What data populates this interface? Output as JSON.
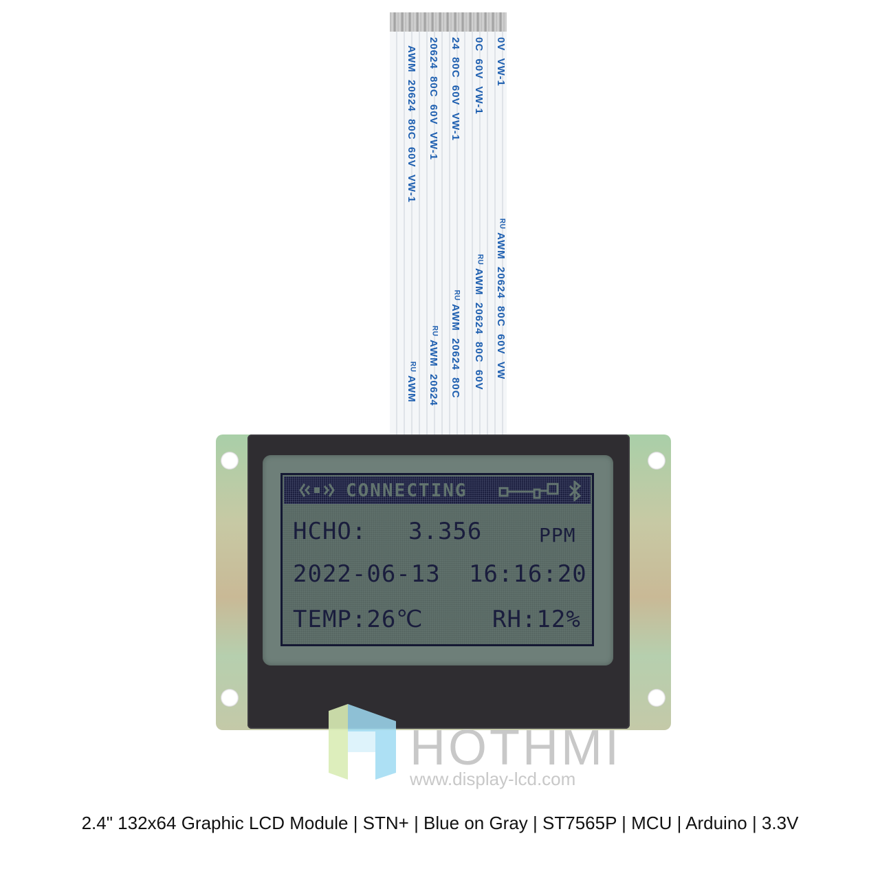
{
  "cable": {
    "print_lines": [
      "0V  VW-1",
      "0C  60V  VW-1",
      "24  80C  60V  VW-1",
      "20624  80C  60V  VW-1",
      "AWM  20624  80C  60V  VW-1"
    ],
    "print_lines_lower": [
      "ᴿᵁ AWM  20624  80C  60V  VW",
      "ᴿᵁ AWM  20624  80C  60V",
      "ᴿᵁ AWM  20624  80C",
      "ᴿᵁ AWM  20624",
      "ᴿᵁ AWM"
    ],
    "color": "#1e5fb0"
  },
  "lcd": {
    "status_bar": {
      "signal_icon": "wireless-signal-icon",
      "status_text": "CONNECTING",
      "key_icon": "key-icon",
      "bluetooth_icon": "bluetooth-icon"
    },
    "rows": [
      {
        "label": "HCHO:",
        "value": "3.356",
        "unit": "PPM"
      },
      {
        "date": "2022-06-13",
        "time": "16:16:20"
      },
      {
        "temp": "TEMP:26℃",
        "humidity": "RH:12%"
      }
    ],
    "colors": {
      "pixel": "#1a1d3d",
      "background": "#5f706b"
    }
  },
  "branding": {
    "name": "HOTHMI",
    "url": "www.display-lcd.com",
    "registered": "®"
  },
  "caption": "2.4\" 132x64 Graphic LCD Module | STN+ | Blue on Gray | ST7565P | MCU | Arduino | 3.3V"
}
